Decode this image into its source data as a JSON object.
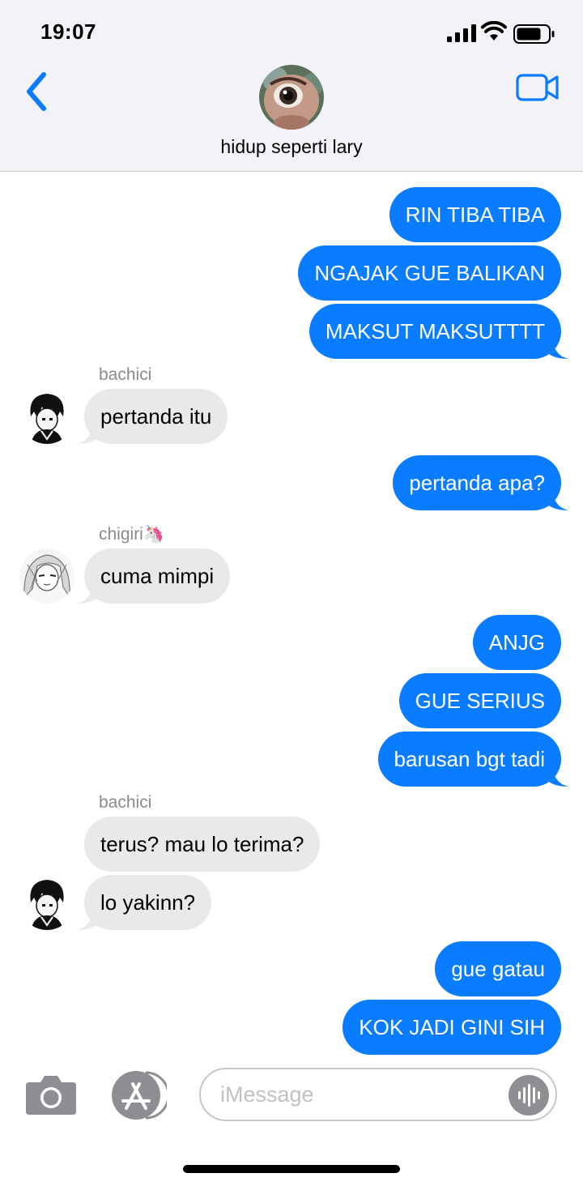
{
  "status_bar": {
    "time": "19:07"
  },
  "conversation": {
    "title": "hidup seperti lary"
  },
  "colors": {
    "outgoing": "#0a7cff",
    "incoming": "#e9e9eb",
    "header_bg": "#f2f2f7",
    "accent": "#0a7cff"
  },
  "icons": {
    "back": "chevron-left-icon",
    "video": "video-camera-icon",
    "camera": "camera-icon",
    "apps": "app-store-icon",
    "audio": "waveform-icon"
  },
  "messages": [
    {
      "direction": "out",
      "text": "RIN TIBA TIBA"
    },
    {
      "direction": "out",
      "text": "NGAJAK GUE BALIKAN"
    },
    {
      "direction": "out",
      "text": "MAKSUT MAKSUTTTT"
    },
    {
      "direction": "in",
      "sender": "bachici",
      "text": "pertanda itu"
    },
    {
      "direction": "out",
      "text": "pertanda apa?"
    },
    {
      "direction": "in",
      "sender": "chigiri🦄",
      "text": "cuma mimpi"
    },
    {
      "direction": "out",
      "text": "ANJG"
    },
    {
      "direction": "out",
      "text": "GUE SERIUS"
    },
    {
      "direction": "out",
      "text": "barusan bgt tadi"
    },
    {
      "direction": "in",
      "sender": "bachici",
      "text": "terus? mau lo terima?"
    },
    {
      "direction": "in",
      "text": "lo yakinn?"
    },
    {
      "direction": "out",
      "text": "gue gatau"
    },
    {
      "direction": "out",
      "text": "KOK JADI GINI SIH"
    }
  ],
  "composer": {
    "placeholder": "iMessage",
    "value": ""
  }
}
